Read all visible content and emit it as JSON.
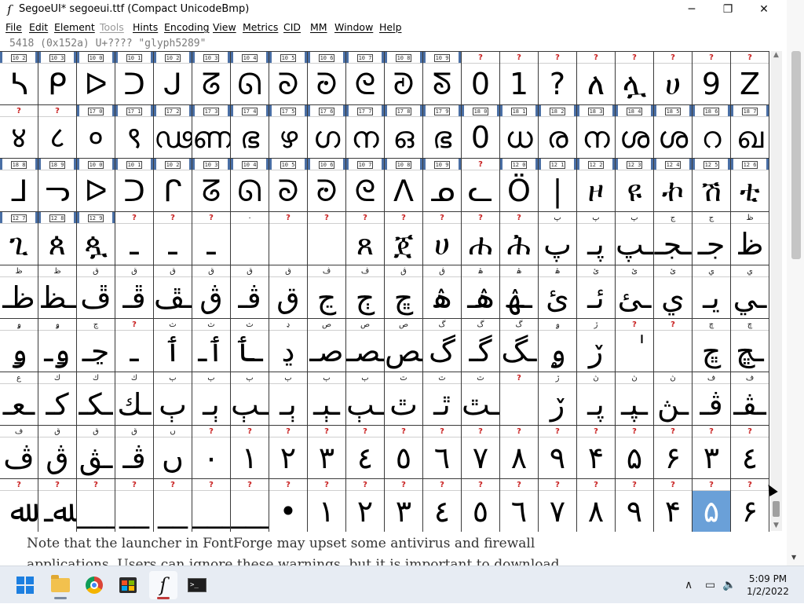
{
  "window": {
    "title": "SegoeUI*  segoeui.ttf (Compact UnicodeBmp)",
    "app_icon": "fontforge-icon",
    "controls": {
      "minimize": "─",
      "maximize": "❐",
      "close": "✕"
    }
  },
  "menu": [
    {
      "label": "File",
      "disabled": false
    },
    {
      "label": "Edit",
      "disabled": false
    },
    {
      "label": "Element",
      "disabled": false
    },
    {
      "label": "Tools",
      "disabled": true
    },
    {
      "label": "Hints",
      "disabled": false
    },
    {
      "label": "Encoding",
      "disabled": false
    },
    {
      "label": "View",
      "disabled": false
    },
    {
      "label": "Metrics",
      "disabled": false
    },
    {
      "label": "CID",
      "disabled": false
    },
    {
      "label": "MM",
      "disabled": false
    },
    {
      "label": "Window",
      "disabled": false
    },
    {
      "label": "Help",
      "disabled": false
    }
  ],
  "info_line": "5418 (0x152a) U+???? \"glyph5289\"",
  "grid": {
    "selected": {
      "row": 8,
      "col": 18
    },
    "rows": [
      {
        "labels": [
          "hex:10 2",
          "hex:10 3",
          "hex:10 0",
          "hex:10 1",
          "hex:10 2",
          "hex:10 3",
          "hex:10 4",
          "hex:10 5",
          "hex:10 6",
          "hex:10 7",
          "hex:10 8",
          "hex:10 9",
          "?",
          "?",
          "?",
          "?",
          "?",
          "?",
          "?",
          "?"
        ],
        "glyphs": [
          "ᓴ",
          "ᑭ",
          "ᐅ",
          "ᑐ",
          "ᒍ",
          "ᘔ",
          "ᘏ",
          "ᘐ",
          "ᘒ",
          "ᘓ",
          "ᘑ",
          "ᘕ",
          "0",
          "1",
          "?",
          "ለ",
          "ሏ",
          "ሀ",
          "9",
          "Z"
        ]
      },
      {
        "labels": [
          "?",
          "?",
          "hex:17 0",
          "hex:17 1",
          "hex:17 2",
          "hex:17 3",
          "hex:17 4",
          "hex:17 5",
          "hex:17 6",
          "hex:17 7",
          "hex:17 8",
          "hex:17 9",
          "hex:18 0",
          "hex:18 1",
          "hex:18 2",
          "hex:18 3",
          "hex:18 4",
          "hex:18 5",
          "hex:18 6",
          "hex:18 7"
        ],
        "glyphs": [
          "४",
          "८",
          "०",
          "९",
          "ഢ",
          "ണ",
          "ഭ",
          "ഴ",
          "ഗ",
          "ന",
          "ഒ",
          "ഭ",
          "0",
          "ധ",
          "ര",
          "ന",
          "ശ",
          "ശ",
          "റ",
          "ഖ"
        ]
      },
      {
        "labels": [
          "hex:18 8",
          "hex:18 9",
          "hex:10 0",
          "hex:10 1",
          "hex:10 2",
          "hex:10 3",
          "hex:10 4",
          "hex:10 5",
          "hex:10 6",
          "hex:10 7",
          "hex:10 8",
          "hex:10 9",
          "?",
          "hex:12 0",
          "hex:12 1",
          "hex:12 2",
          "hex:12 3",
          "hex:12 4",
          "hex:12 5",
          "hex:12 6"
        ],
        "glyphs": [
          "ᒧ",
          "ᓓ",
          "ᐅ",
          "ᑐ",
          "ᒋ",
          "ᘔ",
          "ᘏ",
          "ᘐ",
          "ᘒ",
          "ᘓ",
          "ᐱ",
          "ᓄ",
          "ᓚ",
          "Ö",
          "|",
          "ዞ",
          "ዩ",
          "ኯ",
          "ሽ",
          "ቲ"
        ]
      },
      {
        "labels": [
          "hex:12 7",
          "hex:12 8",
          "hex:12 9",
          "?",
          "?",
          "?",
          "٠",
          "?",
          "?",
          "?",
          "?",
          "?",
          "?",
          "?",
          "پ",
          "پ",
          "پ",
          "ج",
          "ج",
          "ظ"
        ],
        "glyphs": [
          "ጊ",
          "ጰ",
          "ጷ",
          "ـ",
          "ـ",
          "ـ",
          "",
          "",
          "",
          "ጸ",
          "ጀ",
          "ሀ",
          "ሐ",
          "ሕ",
          "پ",
          "پـ",
          "ـپ",
          "ـجـ",
          "جـ",
          "ظ"
        ]
      },
      {
        "labels": [
          "ظ",
          "ظ",
          "ق",
          "ق",
          "ق",
          "ق",
          "ق",
          "ق",
          "ڤ",
          "ڤ",
          "ڨ",
          "ڨ",
          "ۿ",
          "ۿ",
          "ۿ",
          "ئ",
          "ئ",
          "ئ",
          "ي",
          "ي"
        ],
        "glyphs": [
          "ظـ",
          "ـظ",
          "ڦ",
          "ڦـ",
          "ـڦ",
          "ڨ",
          "ڨـ",
          "ق",
          "ڃ",
          "ڄ",
          "ڇ",
          "ۿ",
          "ۿـ",
          "ـۿ",
          "ئ",
          "ئـ",
          "ـئ",
          "ي",
          "يـ",
          "ـي"
        ]
      },
      {
        "labels": [
          "ۅ",
          "ۅ",
          "ڃ",
          "?",
          "ث",
          "ث",
          "ث",
          "ڍ",
          "ص",
          "ص",
          "ص",
          "گ",
          "گ",
          "گ",
          "ۄ",
          "ڒ",
          "?",
          "?",
          "ڇ",
          "ڇ"
        ],
        "glyphs": [
          "ۅ",
          "ۅـ",
          "ڃـ",
          "ـ",
          "ٲ",
          "ٲـ",
          "ـٲ",
          "ڍ",
          "صـ",
          "ـصـ",
          "ـص",
          "گ",
          "گـ",
          "ـگ",
          "ۄ",
          "ڒ",
          "ٰ",
          "",
          "ڇ",
          "ـڇ"
        ]
      },
      {
        "labels": [
          "ع",
          "ك",
          "ك",
          "ك",
          "ٻ",
          "ٻ",
          "ٻ",
          "ٻ",
          "ٻ",
          "ٻ",
          "ٿ",
          "ٿ",
          "ٿ",
          "?",
          "ڒ",
          "ڽ",
          "ڽ",
          "ڽ",
          "ف",
          "ف"
        ],
        "glyphs": [
          "ـعـ",
          "كـ",
          "ـكـ",
          "ـك",
          "ٻ",
          "ٻـ",
          "ـٻ",
          "ٻـ",
          "ـٻـ",
          "ـٻ",
          "ٿ",
          "ٿـ",
          "ـٿ",
          "",
          "ڒ",
          "ڽـ",
          "ـڽـ",
          "ـڽ",
          "ڤـ",
          "ـڤـ"
        ]
      },
      {
        "labels": [
          "ف",
          "ق",
          "ق",
          "ق",
          "ں",
          "?",
          "?",
          "?",
          "?",
          "?",
          "?",
          "?",
          "?",
          "?",
          "?",
          "?",
          "?",
          "?",
          "?",
          "?"
        ],
        "glyphs": [
          "ڤ",
          "ڨ",
          "ـڨ",
          "ڨـ",
          "ں",
          "٠",
          "١",
          "٢",
          "٣",
          "٤",
          "٥",
          "٦",
          "٧",
          "٨",
          "٩",
          "۴",
          "۵",
          "۶",
          "٣",
          "٤"
        ]
      },
      {
        "labels": [
          "?",
          "?",
          "?",
          "?",
          "?",
          "?",
          "?",
          "?",
          "?",
          "?",
          "?",
          "?",
          "?",
          "?",
          "?",
          "?",
          "?",
          "?",
          "?",
          "?"
        ],
        "glyphs": [
          "ﷲ",
          "ﷲـ",
          "___",
          "__",
          "__",
          "___",
          "___",
          "•",
          "١",
          "٢",
          "٣",
          "٤",
          "٥",
          "٦",
          "٧",
          "٨",
          "٩",
          "۴",
          "۵",
          "۶"
        ]
      }
    ]
  },
  "page_text": "Note that the launcher in FontForge may upset some antivirus and firewall applications. Users can ignore these warnings, but it is important to download",
  "taskbar": {
    "apps": [
      {
        "name": "start",
        "icon": "windows-logo-icon",
        "active": false
      },
      {
        "name": "file-explorer",
        "icon": "folder-icon",
        "active": false
      },
      {
        "name": "chrome",
        "icon": "chrome-icon",
        "active": false
      },
      {
        "name": "store",
        "icon": "store-icon",
        "active": false
      },
      {
        "name": "fontforge",
        "icon": "fontforge-icon",
        "active": true
      },
      {
        "name": "terminal",
        "icon": "terminal-icon",
        "active": false
      }
    ],
    "tray": {
      "chevron": "∧",
      "network": "▭",
      "volume": "🔈"
    },
    "clock": {
      "time": "5:09 PM",
      "date": "1/2/2022"
    }
  }
}
